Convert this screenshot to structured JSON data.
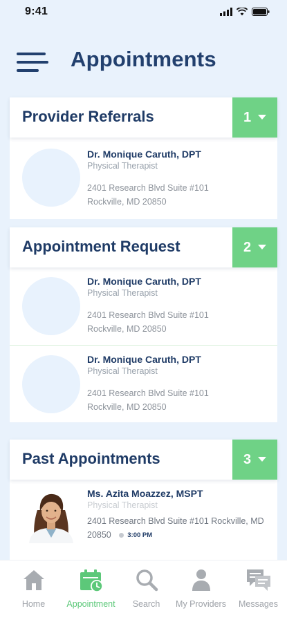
{
  "status_bar": {
    "time": "9:41"
  },
  "header": {
    "title": "Appointments"
  },
  "sections": [
    {
      "title": "Provider Referrals",
      "count": "1",
      "providers": [
        {
          "name": "Dr. Monique Caruth, DPT",
          "title": "Physical Therapist",
          "address_line1": "2401 Research Blvd Suite #101",
          "address_line2": "Rockville, MD 20850"
        }
      ]
    },
    {
      "title": "Appointment Request",
      "count": "2",
      "providers": [
        {
          "name": "Dr. Monique Caruth, DPT",
          "title": "Physical Therapist",
          "address_line1": "2401 Research Blvd Suite #101",
          "address_line2": "Rockville, MD 20850"
        },
        {
          "name": "Dr. Monique Caruth, DPT",
          "title": "Physical Therapist",
          "address_line1": "2401 Research Blvd Suite #101",
          "address_line2": "Rockville, MD 20850"
        }
      ]
    },
    {
      "title": "Past Appointments",
      "count": "3",
      "providers": [
        {
          "name": "Ms. Azita Moazzez, MSPT",
          "title": "Physical Therapist",
          "address": "2401 Research Blvd Suite #101 Rockville, MD 20850",
          "time": "3:00 PM"
        }
      ]
    }
  ],
  "tab_bar": {
    "tabs": [
      {
        "label": "Home",
        "icon": "home-icon"
      },
      {
        "label": "Appointment",
        "icon": "calendar-clock-icon"
      },
      {
        "label": "Search",
        "icon": "search-icon"
      },
      {
        "label": "My Providers",
        "icon": "person-icon"
      },
      {
        "label": "Messages",
        "icon": "chat-icon"
      }
    ],
    "active_tab": "Appointment"
  },
  "colors": {
    "accent_green": "#6fd286",
    "navy": "#1f3b66",
    "background": "#e9f2fc",
    "inactive_gray": "#9ea2a8"
  }
}
